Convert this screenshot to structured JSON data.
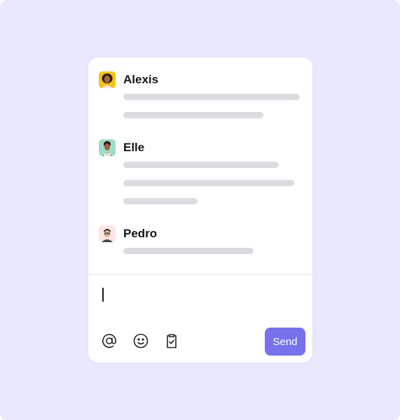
{
  "theme": {
    "background": "#e9e8ff",
    "card": "#ffffff",
    "accent": "#7771ec",
    "placeholder_line": "#dcdce0"
  },
  "messages": [
    {
      "author": "Alexis",
      "avatar": "avatar-alexis",
      "line_widths_pct": [
        100,
        79
      ]
    },
    {
      "author": "Elle",
      "avatar": "avatar-elle",
      "line_widths_pct": [
        88,
        97,
        42
      ]
    },
    {
      "author": "Pedro",
      "avatar": "avatar-pedro",
      "line_widths_pct": [
        74
      ]
    }
  ],
  "composer": {
    "value": "",
    "tools": [
      "at-icon",
      "emoji-icon",
      "clipboard-check-icon"
    ],
    "send_label": "Send"
  }
}
